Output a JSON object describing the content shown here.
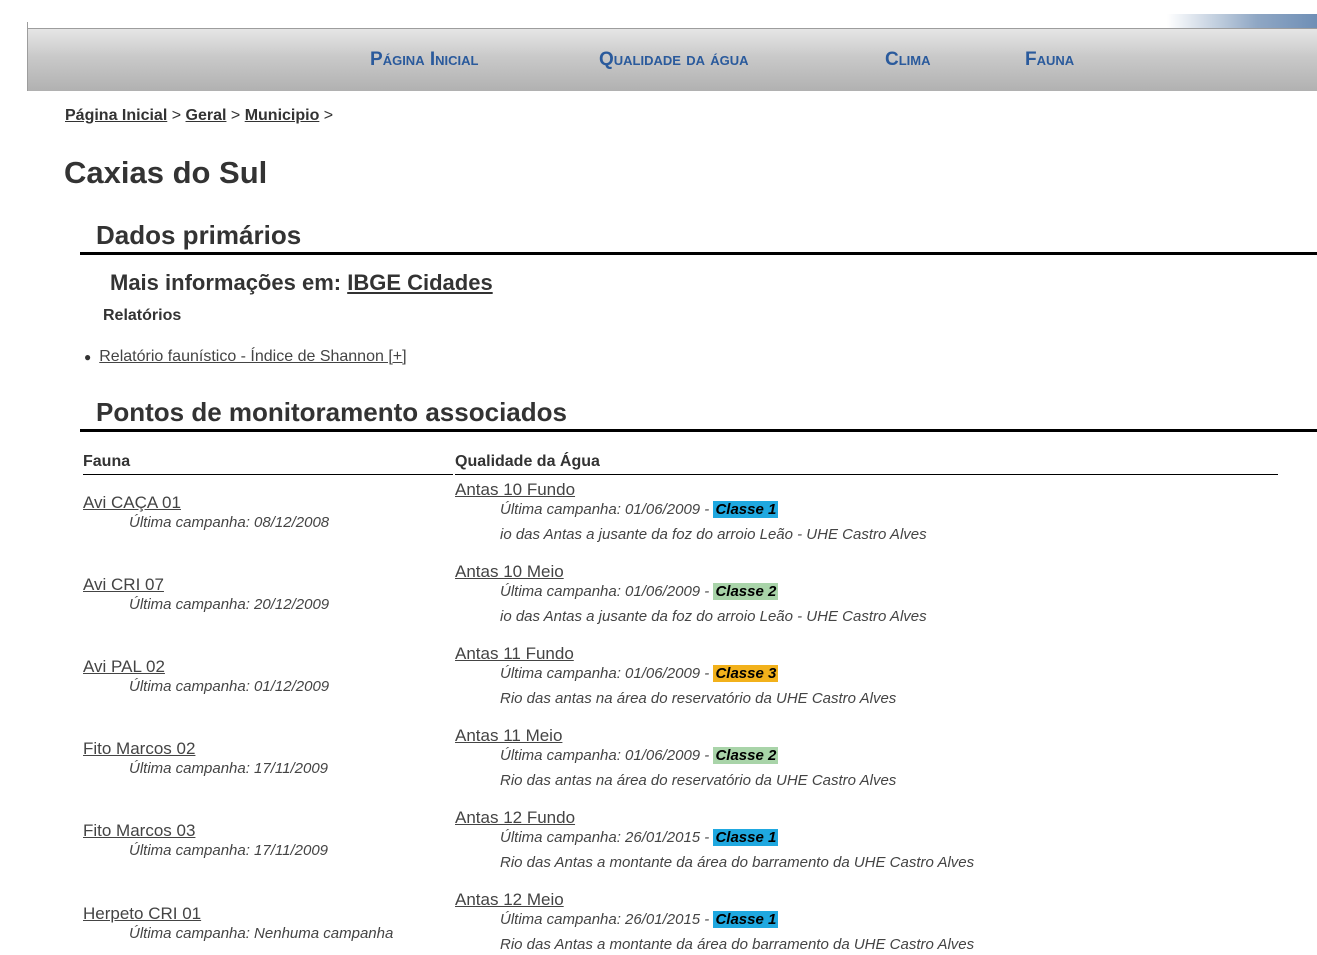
{
  "nav": {
    "items": [
      {
        "first": "P",
        "rest": "ágina ",
        "first2": "I",
        "rest2": "nicial"
      },
      {
        "first": "Q",
        "rest": "ualidade da água",
        "first2": "",
        "rest2": ""
      },
      {
        "first": "C",
        "rest": "lima",
        "first2": "",
        "rest2": ""
      },
      {
        "first": "F",
        "rest": "auna",
        "first2": "",
        "rest2": ""
      }
    ]
  },
  "breadcrumb": {
    "items": [
      "Página Inicial",
      "Geral",
      "Municipio"
    ],
    "separator": ">"
  },
  "page": {
    "title": "Caxias do Sul"
  },
  "primary": {
    "heading": "Dados primários",
    "more_info_prefix": "Mais informações em:",
    "more_info_link": "IBGE Cidades",
    "reports_label": "Relatórios",
    "report_link": "Relatório faunístico - Índice de Shannon [+]"
  },
  "monitoring": {
    "heading": "Pontos de monitoramento associados",
    "fauna_header": "Fauna",
    "water_header": "Qualidade da Água",
    "fauna": [
      {
        "name": "Avi CAÇA 01",
        "last": "Última campanha: 08/12/2008"
      },
      {
        "name": "Avi CRI 07",
        "last": "Última campanha: 20/12/2009"
      },
      {
        "name": "Avi PAL 02",
        "last": "Última campanha: 01/12/2009"
      },
      {
        "name": "Fito Marcos 02",
        "last": "Última campanha: 17/11/2009"
      },
      {
        "name": "Fito Marcos 03",
        "last": "Última campanha: 17/11/2009"
      },
      {
        "name": "Herpeto CRI 01",
        "last": "Última campanha: Nenhuma campanha"
      }
    ],
    "water": [
      {
        "name": "Antas 10 Fundo",
        "last": "Última campanha: 01/06/2009 -",
        "class": "Classe 1",
        "class_color": "#1fa8e0",
        "desc": "io das Antas a jusante da foz do arroio Leão - UHE Castro Alves"
      },
      {
        "name": "Antas 10 Meio",
        "last": "Última campanha: 01/06/2009 -",
        "class": "Classe 2",
        "class_color": "#a9d4a9",
        "desc": "io das Antas a jusante da foz do arroio Leão - UHE Castro Alves"
      },
      {
        "name": "Antas 11 Fundo",
        "last": "Última campanha: 01/06/2009 -",
        "class": "Classe 3",
        "class_color": "#f2b11b",
        "desc": "Rio das antas na área do reservatório da UHE Castro Alves"
      },
      {
        "name": "Antas 11 Meio",
        "last": "Última campanha: 01/06/2009 -",
        "class": "Classe 2",
        "class_color": "#a9d4a9",
        "desc": "Rio das antas na área do reservatório da UHE Castro Alves"
      },
      {
        "name": "Antas 12 Fundo",
        "last": "Última campanha: 26/01/2015 -",
        "class": "Classe 1",
        "class_color": "#1fa8e0",
        "desc": "Rio das Antas a montante da área do barramento da UHE Castro Alves"
      },
      {
        "name": "Antas 12 Meio",
        "last": "Última campanha: 26/01/2015 -",
        "class": "Classe 1",
        "class_color": "#1fa8e0",
        "desc": "Rio das Antas a montante da área do barramento da UHE Castro Alves"
      }
    ]
  }
}
